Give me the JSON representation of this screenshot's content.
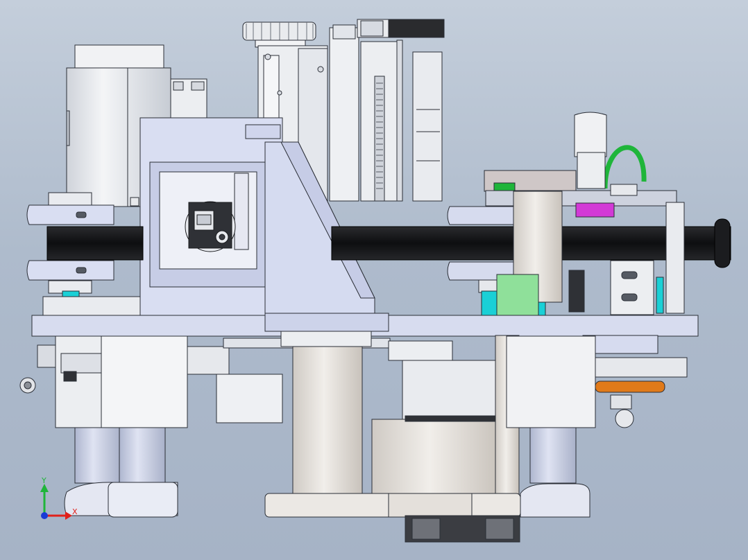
{
  "viewport": {
    "background_top": "#c4cedb",
    "background_bottom": "#a6b3c6"
  },
  "triad": {
    "x_label": "X",
    "y_label": "Y",
    "x_color": "#e0201a",
    "y_color": "#1fb53a",
    "z_color": "#1a3bd6"
  },
  "colors": {
    "part_white": "#eef0f3",
    "part_lavender": "#d6dbef",
    "part_steel": "#c9cfdc",
    "belt": "#111214",
    "accent_cyan": "#1ad0d6",
    "accent_green": "#1fb53a",
    "accent_magenta": "#d23ad6",
    "accent_orange": "#e07a1a",
    "edge": "#2a2e36"
  }
}
